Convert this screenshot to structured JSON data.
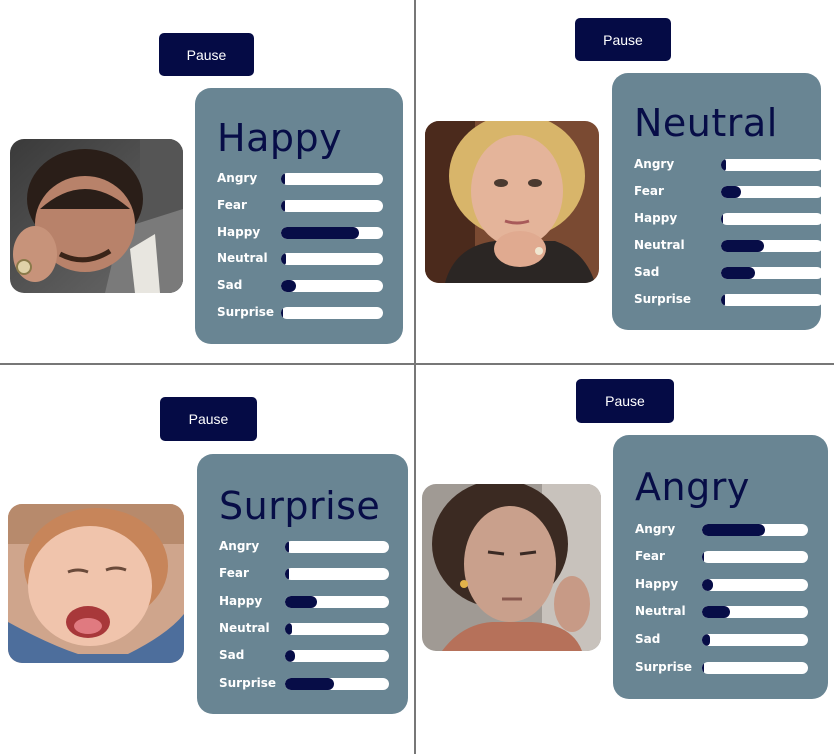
{
  "colors": {
    "panel": "#698593",
    "button": "#050b45",
    "bar_fill": "#070d47",
    "bar_track": "#ffffff"
  },
  "quadrants": [
    {
      "pause_label": "Pause",
      "emotion": "Happy",
      "subject": "man laughing, hand covering face",
      "scores": [
        {
          "label": "Angry",
          "value": 0.02
        },
        {
          "label": "Fear",
          "value": 0.02
        },
        {
          "label": "Happy",
          "value": 0.76
        },
        {
          "label": "Neutral",
          "value": 0.05
        },
        {
          "label": "Sad",
          "value": 0.15
        },
        {
          "label": "Surprise",
          "value": 0.0
        }
      ]
    },
    {
      "pause_label": "Pause",
      "emotion": "Neutral",
      "subject": "blonde woman, chin resting on hand",
      "scores": [
        {
          "label": "Angry",
          "value": 0.05
        },
        {
          "label": "Fear",
          "value": 0.2
        },
        {
          "label": "Happy",
          "value": 0.0
        },
        {
          "label": "Neutral",
          "value": 0.42
        },
        {
          "label": "Sad",
          "value": 0.33
        },
        {
          "label": "Surprise",
          "value": 0.02
        }
      ]
    },
    {
      "pause_label": "Pause",
      "emotion": "Surprise",
      "subject": "toddler with mouth open",
      "scores": [
        {
          "label": "Angry",
          "value": 0.03
        },
        {
          "label": "Fear",
          "value": 0.03
        },
        {
          "label": "Happy",
          "value": 0.31
        },
        {
          "label": "Neutral",
          "value": 0.07
        },
        {
          "label": "Sad",
          "value": 0.1
        },
        {
          "label": "Surprise",
          "value": 0.47
        }
      ]
    },
    {
      "pause_label": "Pause",
      "emotion": "Angry",
      "subject": "woman with serious expression",
      "scores": [
        {
          "label": "Angry",
          "value": 0.59
        },
        {
          "label": "Fear",
          "value": 0.0
        },
        {
          "label": "Happy",
          "value": 0.1
        },
        {
          "label": "Neutral",
          "value": 0.26
        },
        {
          "label": "Sad",
          "value": 0.08
        },
        {
          "label": "Surprise",
          "value": 0.0
        }
      ]
    }
  ]
}
